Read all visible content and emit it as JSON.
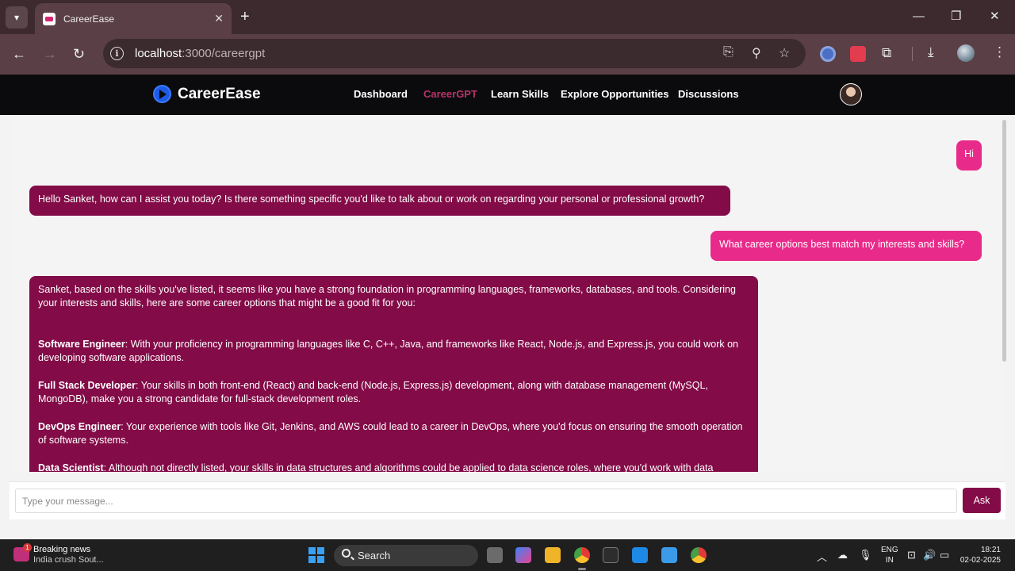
{
  "browser": {
    "tab_title": "CareerEase",
    "url_host": "localhost",
    "url_path": ":3000/careergpt"
  },
  "app": {
    "brand": "CareerEase",
    "nav": [
      {
        "label": "Dashboard",
        "active": false
      },
      {
        "label": "CareerGPT",
        "active": true
      },
      {
        "label": "Learn Skills",
        "active": false
      },
      {
        "label": "Explore Opportunities",
        "active": false
      },
      {
        "label": "Discussions",
        "active": false
      }
    ]
  },
  "chat": {
    "messages": [
      {
        "role": "user",
        "text": "Hi"
      },
      {
        "role": "bot",
        "text": "Hello Sanket, how can I assist you today? Is there something specific you'd like to talk about or work on regarding your personal or professional growth?"
      },
      {
        "role": "user",
        "text": "What career options best match my interests and skills?"
      },
      {
        "role": "bot",
        "intro": "Sanket, based on the skills you've listed, it seems like you have a strong foundation in programming languages, frameworks, databases, and tools. Considering your interests and skills, here are some career options that might be a good fit for you:",
        "options": [
          {
            "title": "Software Engineer",
            "text": ": With your proficiency in programming languages like C, C++, Java, and frameworks like React, Node.js, and Express.js, you could work on developing software applications."
          },
          {
            "title": "Full Stack Developer",
            "text": ": Your skills in both front-end (React) and back-end (Node.js, Express.js) development, along with database management (MySQL, MongoDB), make you a strong candidate for full-stack development roles."
          },
          {
            "title": "DevOps Engineer",
            "text": ": Your experience with tools like Git, Jenkins, and AWS could lead to a career in DevOps, where you'd focus on ensuring the smooth operation of software systems."
          },
          {
            "title": "Data Scientist",
            "text": ": Although not directly listed, your skills in data structures and algorithms could be applied to data science roles, where you'd work with data"
          }
        ]
      }
    ],
    "input_placeholder": "Type your message...",
    "ask_label": "Ask"
  },
  "taskbar": {
    "news_badge": "1",
    "news_title": "Breaking news",
    "news_subtitle": "India crush Sout...",
    "search_label": "Search",
    "lang_line1": "ENG",
    "lang_line2": "IN",
    "time": "18:21",
    "date": "02-02-2025"
  }
}
